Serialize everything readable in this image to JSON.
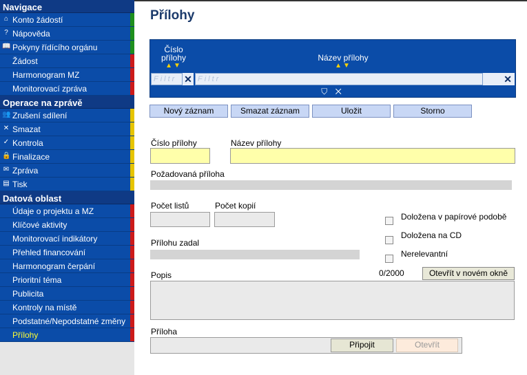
{
  "sidebar": {
    "sections": [
      {
        "title": "Navigace",
        "items": [
          {
            "label": "Konto žádostí",
            "icon": "home-icon",
            "glyph": "⌂",
            "bar": "#1e8f1e"
          },
          {
            "label": "Nápověda",
            "icon": "help-icon",
            "glyph": "?",
            "bar": "#1e8f1e"
          },
          {
            "label": "Pokyny řídícího orgánu",
            "icon": "book-icon",
            "glyph": "📖",
            "bar": "#1e8f1e"
          },
          {
            "label": "Žádost",
            "icon": "",
            "glyph": "",
            "bar": "#cc1a1a"
          },
          {
            "label": "Harmonogram MZ",
            "icon": "",
            "glyph": "",
            "bar": "#cc1a1a"
          },
          {
            "label": "Monitorovací zpráva",
            "icon": "",
            "glyph": "",
            "bar": "#cc1a1a"
          }
        ]
      },
      {
        "title": "Operace na zprávě",
        "items": [
          {
            "label": "Zrušení sdílení",
            "icon": "users-icon",
            "glyph": "👥",
            "bar": "#e6c400"
          },
          {
            "label": "Smazat",
            "icon": "delete-icon",
            "glyph": "✕",
            "bar": "#e6c400"
          },
          {
            "label": "Kontrola",
            "icon": "check-icon",
            "glyph": "✓",
            "bar": "#e6c400"
          },
          {
            "label": "Finalizace",
            "icon": "lock-icon",
            "glyph": "🔒",
            "bar": "#e6c400"
          },
          {
            "label": "Zpráva",
            "icon": "mail-icon",
            "glyph": "✉",
            "bar": "#e6c400"
          },
          {
            "label": "Tisk",
            "icon": "print-icon",
            "glyph": "▤",
            "bar": "#e6c400"
          }
        ]
      },
      {
        "title": "Datová oblast",
        "items": [
          {
            "label": "Údaje o projektu a MZ",
            "icon": "",
            "glyph": "",
            "bar": "#cc1a1a"
          },
          {
            "label": "Klíčové aktivity",
            "icon": "",
            "glyph": "",
            "bar": "#cc1a1a"
          },
          {
            "label": "Monitorovací indikátory",
            "icon": "",
            "glyph": "",
            "bar": "#cc1a1a"
          },
          {
            "label": "Přehled financování",
            "icon": "",
            "glyph": "",
            "bar": "#cc1a1a"
          },
          {
            "label": "Harmonogram čerpání",
            "icon": "",
            "glyph": "",
            "bar": "#cc1a1a"
          },
          {
            "label": "Prioritní téma",
            "icon": "",
            "glyph": "",
            "bar": "#cc1a1a"
          },
          {
            "label": "Publicita",
            "icon": "",
            "glyph": "",
            "bar": "#cc1a1a"
          },
          {
            "label": "Kontroly na místě",
            "icon": "",
            "glyph": "",
            "bar": "#cc1a1a"
          },
          {
            "label": "Podstatné/Nepodstatné změny",
            "icon": "",
            "glyph": "",
            "bar": "#cc1a1a"
          },
          {
            "label": "Přílohy",
            "icon": "",
            "glyph": "",
            "bar": "#cc1a1a",
            "active": true
          }
        ]
      }
    ]
  },
  "page": {
    "title": "Přílohy"
  },
  "grid": {
    "columns": [
      {
        "label_line1": "Číslo",
        "label_line2": "přílohy"
      },
      {
        "label_line1": "Název přílohy",
        "label_line2": ""
      }
    ],
    "sort_arrows": "▲▼",
    "filter_placeholder": "Filtr",
    "filter_clear": "✕",
    "filter_bar": "⛉ ✕"
  },
  "toolbar": {
    "new": "Nový záznam",
    "delete": "Smazat záznam",
    "save": "Uložit",
    "cancel": "Storno"
  },
  "form": {
    "cislo_prilohy": {
      "label": "Číslo přílohy",
      "value": ""
    },
    "nazev_prilohy": {
      "label": "Název přílohy",
      "value": ""
    },
    "pozadovana": {
      "label": "Požadovaná příloha"
    },
    "pocet_listu": {
      "label": "Počet listů",
      "value": ""
    },
    "pocet_kopii": {
      "label": "Počet kopií",
      "value": ""
    },
    "prilohu_zadal": {
      "label": "Přílohu zadal"
    },
    "checkboxes": [
      "Doložena v papírové podobě",
      "Doložena na CD",
      "Nerelevantní"
    ],
    "popis": {
      "label": "Popis",
      "counter": "0/2000",
      "open_button": "Otevřít v novém okně",
      "value": ""
    },
    "priloha": {
      "label": "Příloha",
      "attach": "Připojit",
      "open": "Otevřít"
    }
  },
  "colors": {
    "nav_bg": "#0b4ca8",
    "section_head": "#0f3a85",
    "title": "#1b3a6b",
    "required_field": "#ffffaa"
  }
}
